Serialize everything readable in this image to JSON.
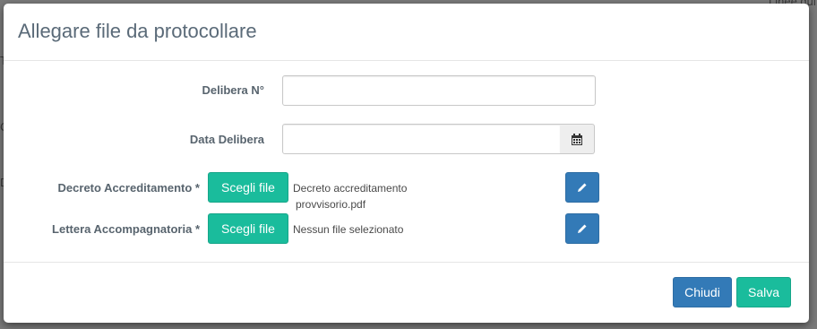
{
  "background": {
    "top_right_text": "Linee gui",
    "left_fragments": [
      "T",
      "C",
      "D"
    ]
  },
  "dialog": {
    "title": "Allegare file da protocollare",
    "close_icon": "none",
    "fields": {
      "delibera_number": {
        "label": "Delibera N°",
        "value": "",
        "placeholder": ""
      },
      "data_delibera": {
        "label": "Data Delibera",
        "value": "",
        "placeholder": "",
        "icon": "calendar-icon"
      },
      "decreto_accreditamento": {
        "label": "Decreto Accreditamento *",
        "button_label": "Scegli file",
        "file_name_line1": "Decreto accreditamento",
        "file_name_line2": "provvisorio.pdf",
        "edit_icon": "pencil-icon"
      },
      "lettera_accompagnatoria": {
        "label": "Lettera Accompagnatoria *",
        "button_label": "Scegli file",
        "file_name": "Nessun file selezionato",
        "edit_icon": "pencil-icon"
      }
    },
    "footer": {
      "close_label": "Chiudi",
      "save_label": "Salva"
    }
  },
  "colors": {
    "primary": "#337ab7",
    "success": "#1abc9c",
    "title": "#5a6a78",
    "label": "#58646e"
  }
}
